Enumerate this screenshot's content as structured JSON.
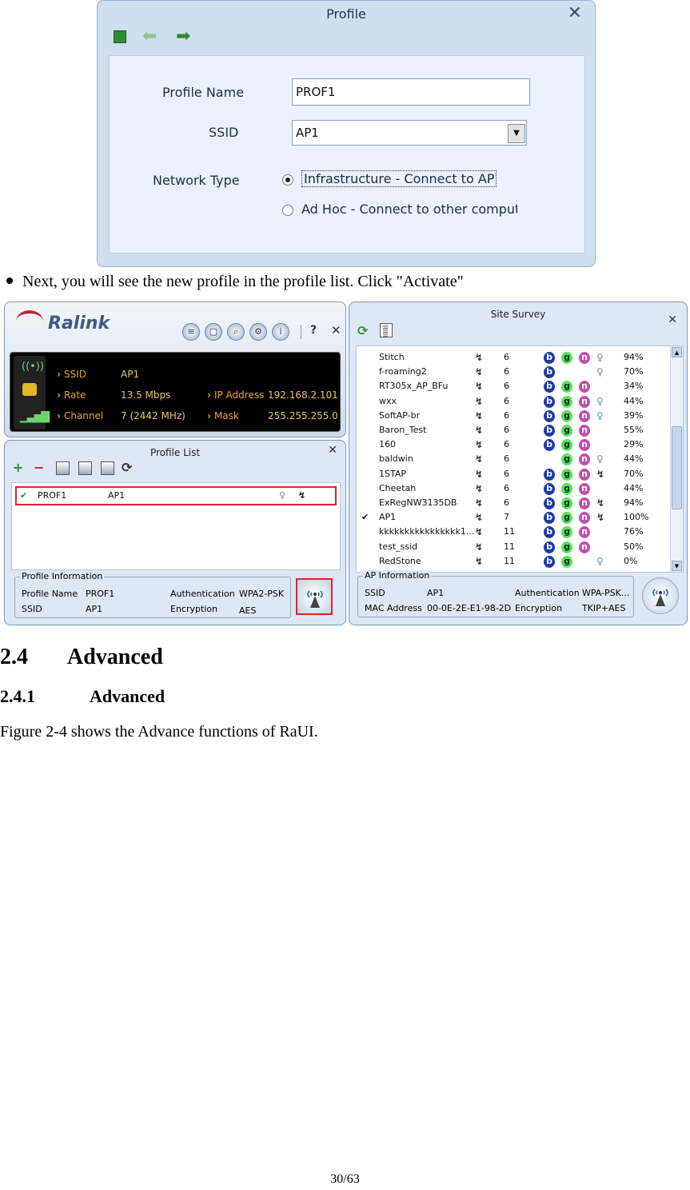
{
  "profile_dialog": {
    "title": "Profile",
    "profile_name_label": "Profile Name",
    "profile_name_value": "PROF1",
    "ssid_label": "SSID",
    "ssid_value": "AP1",
    "network_type_label": "Network Type",
    "option_infrastructure": "Infrastructure - Connect to AP",
    "option_adhoc": "Ad Hoc - Connect to other computer",
    "selected_option": "infrastructure"
  },
  "bullet_text": "Next, you will see the new profile in the profile list. Click \"Activate\"",
  "ralink": {
    "brand": "Ralink",
    "status": [
      {
        "label": "SSID",
        "value": "AP1"
      },
      {
        "label": "Rate",
        "value": "13.5 Mbps"
      },
      {
        "label": "Channel",
        "value": "7 (2442 MHz)"
      },
      {
        "label": "IP Address",
        "value": "192.168.2.101"
      },
      {
        "label": "Mask",
        "value": "255.255.255.0"
      }
    ]
  },
  "profile_list": {
    "title": "Profile List",
    "row": {
      "profile": "PROF1",
      "ssid": "AP1"
    },
    "info_legend": "Profile Information",
    "info": {
      "profile_name_label": "Profile Name",
      "profile_name": "PROF1",
      "ssid_label": "SSID",
      "ssid": "AP1",
      "auth_label": "Authentication",
      "auth": "WPA2-PSK",
      "enc_label": "Encryption",
      "enc": "AES"
    }
  },
  "site_survey": {
    "title": "Site Survey",
    "rows": [
      {
        "name": "Stitch",
        "ch": "6",
        "b": true,
        "g": true,
        "n": true,
        "key": true,
        "wps": false,
        "signal": "94%"
      },
      {
        "name": "f-roaming2",
        "ch": "6",
        "b": true,
        "g": false,
        "n": false,
        "key": true,
        "wps": false,
        "signal": "70%"
      },
      {
        "name": "RT305x_AP_BFu",
        "ch": "6",
        "b": true,
        "g": true,
        "n": true,
        "key": false,
        "wps": false,
        "signal": "34%"
      },
      {
        "name": "wxx",
        "ch": "6",
        "b": true,
        "g": true,
        "n": true,
        "key": true,
        "wps": false,
        "signal": "44%"
      },
      {
        "name": "SoftAP-br",
        "ch": "6",
        "b": true,
        "g": true,
        "n": true,
        "key": true,
        "wps": false,
        "signal": "39%"
      },
      {
        "name": "Baron_Test",
        "ch": "6",
        "b": true,
        "g": true,
        "n": true,
        "key": false,
        "wps": false,
        "signal": "55%"
      },
      {
        "name": "160",
        "ch": "6",
        "b": true,
        "g": true,
        "n": true,
        "key": false,
        "wps": false,
        "signal": "29%"
      },
      {
        "name": "baldwin",
        "ch": "6",
        "b": false,
        "g": true,
        "n": true,
        "key": true,
        "wps": false,
        "signal": "44%"
      },
      {
        "name": "1STAP",
        "ch": "6",
        "b": true,
        "g": true,
        "n": true,
        "key": false,
        "wps": true,
        "signal": "70%"
      },
      {
        "name": "Cheetah",
        "ch": "6",
        "b": true,
        "g": true,
        "n": true,
        "key": false,
        "wps": false,
        "signal": "44%"
      },
      {
        "name": "ExRegNW3135DB",
        "ch": "6",
        "b": true,
        "g": true,
        "n": true,
        "key": false,
        "wps": true,
        "signal": "94%"
      },
      {
        "name": "AP1",
        "ch": "7",
        "b": true,
        "g": true,
        "n": true,
        "key": false,
        "wps": true,
        "signal": "100%",
        "connected": true
      },
      {
        "name": "kkkkkkkkkkkkkkkk1...",
        "ch": "11",
        "b": true,
        "g": true,
        "n": true,
        "key": false,
        "wps": false,
        "signal": "76%"
      },
      {
        "name": "test_ssid",
        "ch": "11",
        "b": true,
        "g": true,
        "n": true,
        "key": false,
        "wps": false,
        "signal": "50%"
      },
      {
        "name": "RedStone",
        "ch": "11",
        "b": true,
        "g": true,
        "n": false,
        "key": true,
        "wps": false,
        "signal": "0%"
      }
    ],
    "info_legend": "AP Information",
    "info": {
      "ssid_label": "SSID",
      "ssid": "AP1",
      "mac_label": "MAC Address",
      "mac": "00-0E-2E-E1-98-2D",
      "auth_label": "Authentication",
      "auth": "WPA-PSK...",
      "enc_label": "Encryption",
      "enc": "TKIP+AES"
    }
  },
  "section": {
    "number": "2.4",
    "title": "Advanced"
  },
  "subsection": {
    "number": "2.4.1",
    "title": "Advanced"
  },
  "paragraph": "Figure 2-4 shows the Advance functions of RaUI.",
  "page_number": "30/63"
}
